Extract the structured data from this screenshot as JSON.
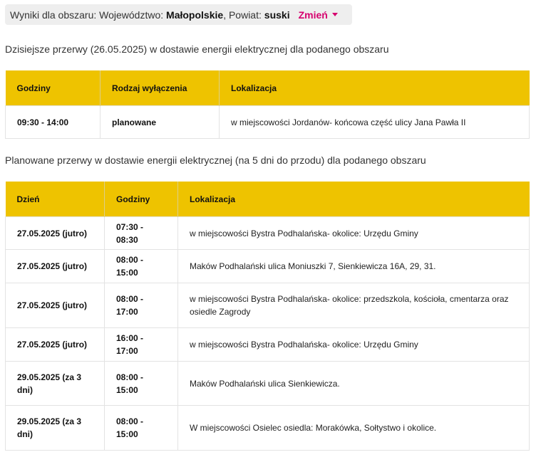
{
  "area": {
    "prefix": "Wyniki dla obszaru: Województwo:",
    "voivodeship": "Małopolskie",
    "county_prefix": ", Powiat:",
    "county": "suski",
    "change_label": "Zmień",
    "change_icon": "caret-down-icon"
  },
  "today": {
    "title": "Dzisiejsze przerwy (26.05.2025) w dostawie energii elektrycznej dla podanego obszaru",
    "columns": [
      "Godziny",
      "Rodzaj wyłączenia",
      "Lokalizacja"
    ],
    "rows": [
      {
        "hours": "09:30 - 14:00",
        "type": "planowane",
        "location": "w miejscowości Jordanów- końcowa część ulicy Jana Pawła II"
      }
    ]
  },
  "planned": {
    "title": "Planowane przerwy w dostawie energii elektrycznej (na 5 dni do przodu) dla podanego obszaru",
    "columns": [
      "Dzień",
      "Godziny",
      "Lokalizacja"
    ],
    "rows": [
      {
        "day": "27.05.2025 (jutro)",
        "hours": "07:30 - 08:30",
        "location": "w miejscowości Bystra Podhalańska- okolice: Urzędu Gminy"
      },
      {
        "day": "27.05.2025 (jutro)",
        "hours": "08:00 - 15:00",
        "location": "Maków Podhalański ulica Moniuszki 7, Sienkiewicza 16A, 29, 31."
      },
      {
        "day": "27.05.2025 (jutro)",
        "hours": "08:00 - 17:00",
        "location": "w miejscowości Bystra Podhalańska- okolice: przedszkola, kościoła, cmentarza oraz osiedle Zagrody"
      },
      {
        "day": "27.05.2025 (jutro)",
        "hours": "16:00 - 17:00",
        "location": "w miejscowości Bystra Podhalańska- okolice: Urzędu Gminy"
      },
      {
        "day": "29.05.2025 (za 3 dni)",
        "hours": "08:00 - 15:00",
        "location": "Maków Podhalański ulica Sienkiewicza."
      },
      {
        "day": "29.05.2025 (za 3 dni)",
        "hours": "08:00 - 15:00",
        "location": "W miejscowości Osielec osiedla: Morakówka, Sołtystwo i okolice."
      }
    ]
  },
  "colors": {
    "header_bg": "#eec300",
    "accent": "#d6006e"
  }
}
